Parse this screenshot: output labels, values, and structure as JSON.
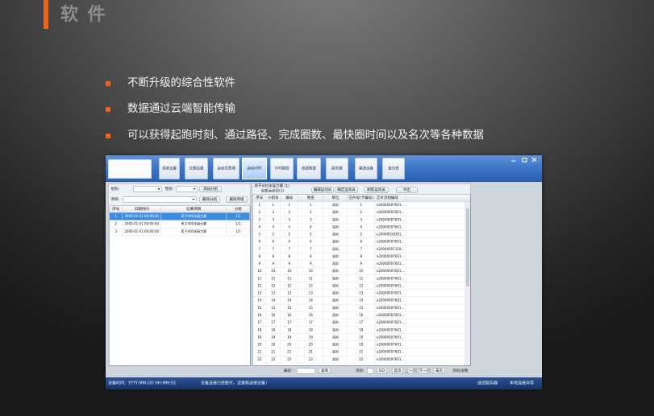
{
  "slide": {
    "title": "软 件",
    "bullets": [
      "不断升级的综合性软件",
      "数据通过云端智能传输",
      "可以获得起跑时刻、通过路径、完成圈数、最快圈时间以及名次等各种数据"
    ]
  },
  "colors": {
    "accent": "#e8661e",
    "app_header": "#3a72c4",
    "selected_row": "#3b8de0",
    "status_bar": "#1f3f7a"
  },
  "app": {
    "window_controls": [
      "minimize-icon",
      "maximize-icon",
      "close-icon"
    ],
    "toolbar": [
      {
        "label": "系统设置",
        "active": false
      },
      {
        "label": "比赛设置",
        "active": false
      },
      {
        "label": "运动员管理",
        "active": false
      },
      {
        "label": "自动对时",
        "active": true
      },
      {
        "label": "计时数据",
        "active": false
      },
      {
        "label": "成绩数据",
        "active": false
      },
      {
        "label": "服务器",
        "active": false
      },
      {
        "label": "播送设备",
        "active": false
      },
      {
        "label": "查分表",
        "active": false
      }
    ],
    "groups_panel": {
      "group_label": "组别:",
      "group_value": "",
      "gender_label": "性别:",
      "gender_value": "",
      "add_group": "添加分组",
      "event_label": "项目:",
      "event_value": "",
      "delete_group": "删除分组",
      "delete_event_group": "删除项组",
      "columns": [
        "序号",
        "日期时间",
        "比赛项目",
        "分组"
      ],
      "rows": [
        [
          "1",
          "2000-01-01 00:00:00",
          "男子400米接力赛",
          "1/1"
        ],
        [
          "2",
          "2000-01-01 00:00:00",
          "男子400米接力赛",
          "1/1"
        ],
        [
          "3",
          "2000-01-01 00:00:00",
          "男子400米接力赛",
          "1/1"
        ]
      ],
      "selected_row": 0
    },
    "athletes_panel": {
      "title": "男子400米接力赛 (1)",
      "subtitle": "全部运动员(1)",
      "buttons": [
        "编辑运动员",
        "确定运动员",
        "刷新运动员",
        "导出"
      ],
      "columns": [
        "序号",
        "小组号",
        "编号",
        "姓名",
        "单位",
        "芯片号(卡编号)",
        "芯片识别编号"
      ],
      "rows": [
        [
          "1",
          "1",
          "1",
          "1",
          "深圳",
          "1",
          "e20040007601..."
        ],
        [
          "2",
          "2",
          "2",
          "2",
          "深圳",
          "2",
          "e20040007601..."
        ],
        [
          "3",
          "3",
          "3",
          "3",
          "深圳",
          "3",
          "e20040007601..."
        ],
        [
          "4",
          "4",
          "4",
          "4",
          "深圳",
          "4",
          "e20040007601..."
        ],
        [
          "5",
          "5",
          "5",
          "5",
          "深圳",
          "5",
          "e20040018301..."
        ],
        [
          "6",
          "6",
          "6",
          "6",
          "深圳",
          "6",
          "e20040007601..."
        ],
        [
          "7",
          "7",
          "7",
          "7",
          "深圳",
          "7",
          "e20040007119..."
        ],
        [
          "8",
          "8",
          "8",
          "8",
          "深圳",
          "8",
          "e20040007601..."
        ],
        [
          "9",
          "9",
          "9",
          "9",
          "深圳",
          "9",
          "e20040007601..."
        ],
        [
          "10",
          "10",
          "10",
          "10",
          "深圳",
          "10",
          "e20040007601..."
        ],
        [
          "11",
          "11",
          "11",
          "11",
          "深圳",
          "11",
          "e20040007601..."
        ],
        [
          "12",
          "12",
          "12",
          "12",
          "深圳",
          "12",
          "e20040007601..."
        ],
        [
          "13",
          "13",
          "13",
          "13",
          "深圳",
          "13",
          "e20040007601..."
        ],
        [
          "14",
          "14",
          "14",
          "14",
          "深圳",
          "14",
          "e20040007601..."
        ],
        [
          "15",
          "15",
          "15",
          "15",
          "深圳",
          "15",
          "e20040007601..."
        ],
        [
          "16",
          "16",
          "16",
          "16",
          "深圳",
          "16",
          "e20040007601..."
        ],
        [
          "17",
          "17",
          "17",
          "17",
          "深圳",
          "17",
          "e20040007601..."
        ],
        [
          "18",
          "18",
          "18",
          "18",
          "深圳",
          "18",
          "e20040007601..."
        ],
        [
          "19",
          "19",
          "19",
          "19",
          "深圳",
          "19",
          "e20040007601..."
        ],
        [
          "20",
          "20",
          "20",
          "20",
          "深圳",
          "20",
          "e20040007601..."
        ],
        [
          "21",
          "21",
          "21",
          "21",
          "深圳",
          "21",
          "e20040007601..."
        ],
        [
          "22",
          "22",
          "22",
          "22",
          "深圳",
          "22",
          "e20040007601..."
        ]
      ]
    },
    "pager": {
      "number_label": "编号:",
      "number_value": "",
      "search": "查询",
      "page_label": "页码:",
      "page_value": "",
      "go": "GO",
      "first": "首页",
      "prev": "上一页",
      "next": "下一页",
      "last": "末页",
      "page_total": "页码/总数"
    },
    "status_bar": {
      "device_time": "设备时间：YYYY-MM-DD HH:MM:SS",
      "message": "设备连接已经断开，请重新连接设备！",
      "server": "成绩服务器",
      "local": "本地连接异常"
    }
  }
}
